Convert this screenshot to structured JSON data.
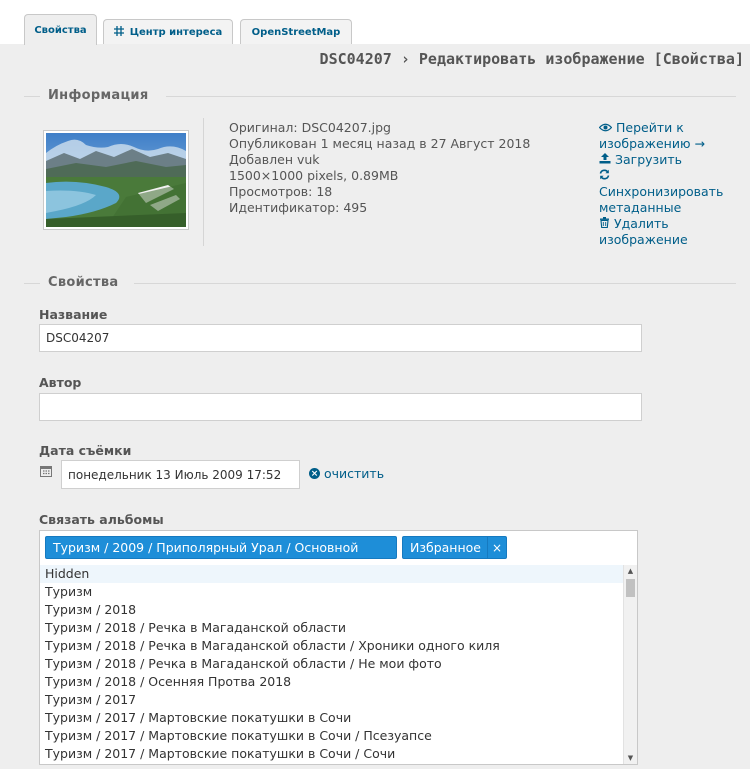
{
  "tabs": [
    {
      "label": "Свойства",
      "icon": "",
      "active": true
    },
    {
      "label": "Центр интереса",
      "icon": "crosshair-icon",
      "active": false
    },
    {
      "label": "OpenStreetMap",
      "icon": "",
      "active": false
    }
  ],
  "page_title": "DSC04207 › Редактировать изображение [Свойства]",
  "info_section": {
    "legend": "Информация",
    "lines": [
      "Оригинал: DSC04207.jpg",
      "Опубликован 1 месяц назад в 27 Август 2018",
      "Добавлен vuk",
      "1500×1000 pixels, 0.89MB",
      "Просмотров: 18",
      "Идентификатор: 495"
    ],
    "actions": {
      "view": {
        "line1": "Перейти к",
        "line2": "изображению →",
        "icon": "eye-icon"
      },
      "upload": {
        "label": "Загрузить",
        "icon": "upload-icon"
      },
      "sync": {
        "line1": "Синхронизировать",
        "line2": "метаданные",
        "icon": "refresh-icon"
      },
      "delete": {
        "line1": "Удалить",
        "line2": "изображение",
        "icon": "trash-icon"
      }
    }
  },
  "props_section": {
    "legend": "Свойства",
    "name_label": "Название",
    "name_value": "DSC04207",
    "author_label": "Автор",
    "author_value": "",
    "date_label": "Дата съёмки",
    "date_value": "понедельник 13 Июль 2009 17:52",
    "clear_label": "очистить",
    "albums_label": "Связать альбомы",
    "selected_albums": [
      "Туризм / 2009 / Приполярный Урал / Основной",
      "Избранное"
    ],
    "remove_symbol": "×",
    "album_options": [
      "Hidden",
      "Туризм",
      "Туризм / 2018",
      "Туризм / 2018 / Речка в Магаданской области",
      "Туризм / 2018 / Речка в Магаданской области / Хроники одного киля",
      "Туризм / 2018 / Речка в Магаданской области / Не мои фото",
      "Туризм / 2018 / Осенняя Протва 2018",
      "Туризм / 2017",
      "Туризм / 2017 / Мартовские покатушки в Сочи",
      "Туризм / 2017 / Мартовские покатушки в Сочи / Псезуапсе",
      "Туризм / 2017 / Мартовские покатушки в Сочи / Сочи"
    ]
  },
  "colors": {
    "accent": "#005e89",
    "chip": "#1e8ed8",
    "background": "#eeeeee"
  }
}
